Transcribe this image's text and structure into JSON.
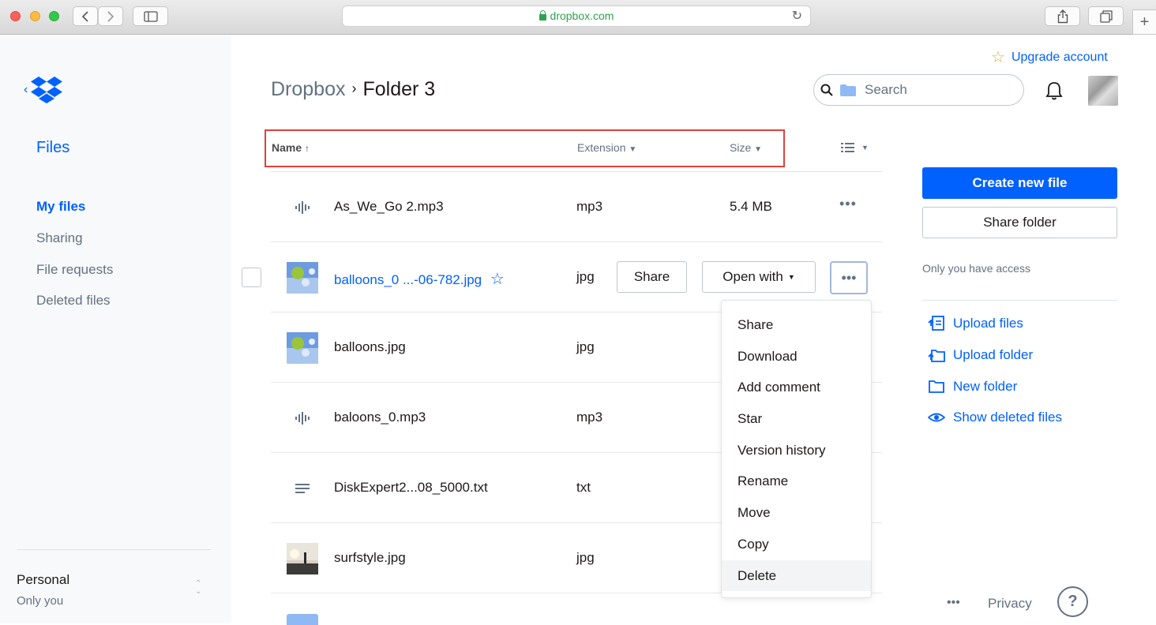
{
  "browser": {
    "url": "dropbox.com"
  },
  "sidebar": {
    "section_title": "Files",
    "items": [
      {
        "label": "My files",
        "active": true
      },
      {
        "label": "Sharing",
        "active": false
      },
      {
        "label": "File requests",
        "active": false
      },
      {
        "label": "Deleted files",
        "active": false
      }
    ],
    "account_name": "Personal",
    "account_sub": "Only you",
    "brand_color": "#0061fe"
  },
  "header": {
    "breadcrumb_root": "Dropbox",
    "breadcrumb_current": "Folder 3",
    "search_placeholder": "Search",
    "upgrade_label": "Upgrade account"
  },
  "table": {
    "columns": {
      "name": "Name",
      "extension": "Extension",
      "size": "Size"
    },
    "rows": [
      {
        "name": "As_We_Go 2.mp3",
        "ext": "mp3",
        "size": "5.4 MB",
        "icon": "audio-file-icon"
      },
      {
        "name": "balloons_0 ...-06-782.jpg",
        "ext": "jpg",
        "size": "",
        "icon": "image-thumbnail",
        "selected": true
      },
      {
        "name": "balloons.jpg",
        "ext": "jpg",
        "size": "",
        "icon": "image-thumbnail"
      },
      {
        "name": "baloons_0.mp3",
        "ext": "mp3",
        "size": "",
        "icon": "audio-file-icon"
      },
      {
        "name": "DiskExpert2...08_5000.txt",
        "ext": "txt",
        "size": "",
        "icon": "text-file-icon"
      },
      {
        "name": "surfstyle.jpg",
        "ext": "jpg",
        "size": "",
        "icon": "image-thumbnail"
      }
    ],
    "row_actions": {
      "share": "Share",
      "open_with": "Open with"
    }
  },
  "context_menu": {
    "items": [
      "Share",
      "Download",
      "Add comment",
      "Star",
      "Version history",
      "Rename",
      "Move",
      "Copy",
      "Delete"
    ],
    "hovered": "Delete"
  },
  "right_panel": {
    "create_new_file": "Create new file",
    "share_folder": "Share folder",
    "access_note": "Only you have access",
    "actions": [
      {
        "label": "Upload files",
        "icon": "upload-files-icon"
      },
      {
        "label": "Upload folder",
        "icon": "upload-folder-icon"
      },
      {
        "label": "New folder",
        "icon": "new-folder-icon"
      },
      {
        "label": "Show deleted files",
        "icon": "eye-icon"
      }
    ]
  },
  "footer": {
    "more": "•••",
    "privacy": "Privacy",
    "help": "?"
  }
}
